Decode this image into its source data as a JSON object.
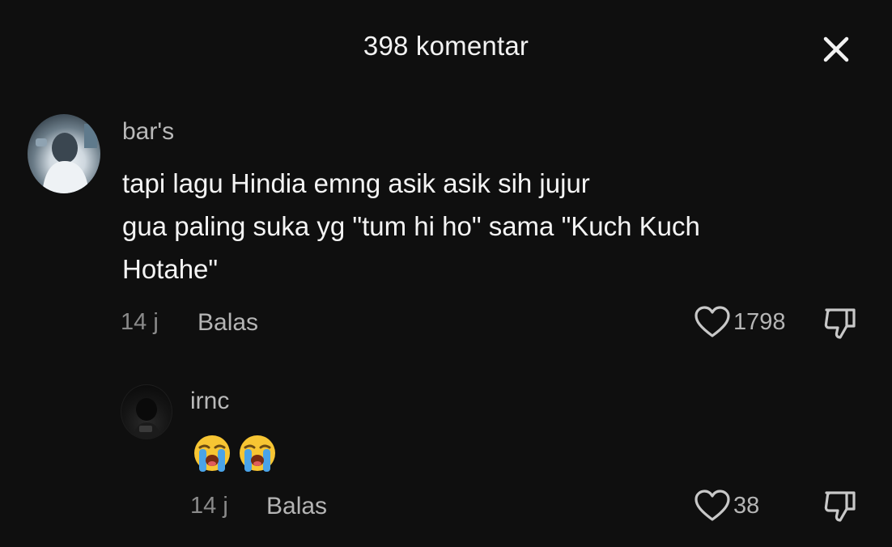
{
  "header": {
    "title": "398 komentar"
  },
  "comments": [
    {
      "username": "bar's",
      "text_lines": [
        "tapi lagu Hindia emng asik asik sih jujur",
        "gua paling suka yg \"tum hi ho\" sama \"Kuch Kuch",
        "Hotahe\""
      ],
      "time": "14 j",
      "reply_label": "Balas",
      "likes": "1798"
    },
    {
      "username": "irnc",
      "emojis": [
        "loudly-crying-face",
        "loudly-crying-face"
      ],
      "time": "14 j",
      "reply_label": "Balas",
      "likes": "38"
    }
  ],
  "colors": {
    "background": "#0f0f0f",
    "primary_text": "#f4f4f4",
    "secondary_text": "#b5b5b5",
    "muted_text": "#8a8a8a"
  },
  "icons": [
    "close-icon",
    "heart-icon",
    "thumbs-down-icon",
    "loudly-crying-face-emoji"
  ]
}
